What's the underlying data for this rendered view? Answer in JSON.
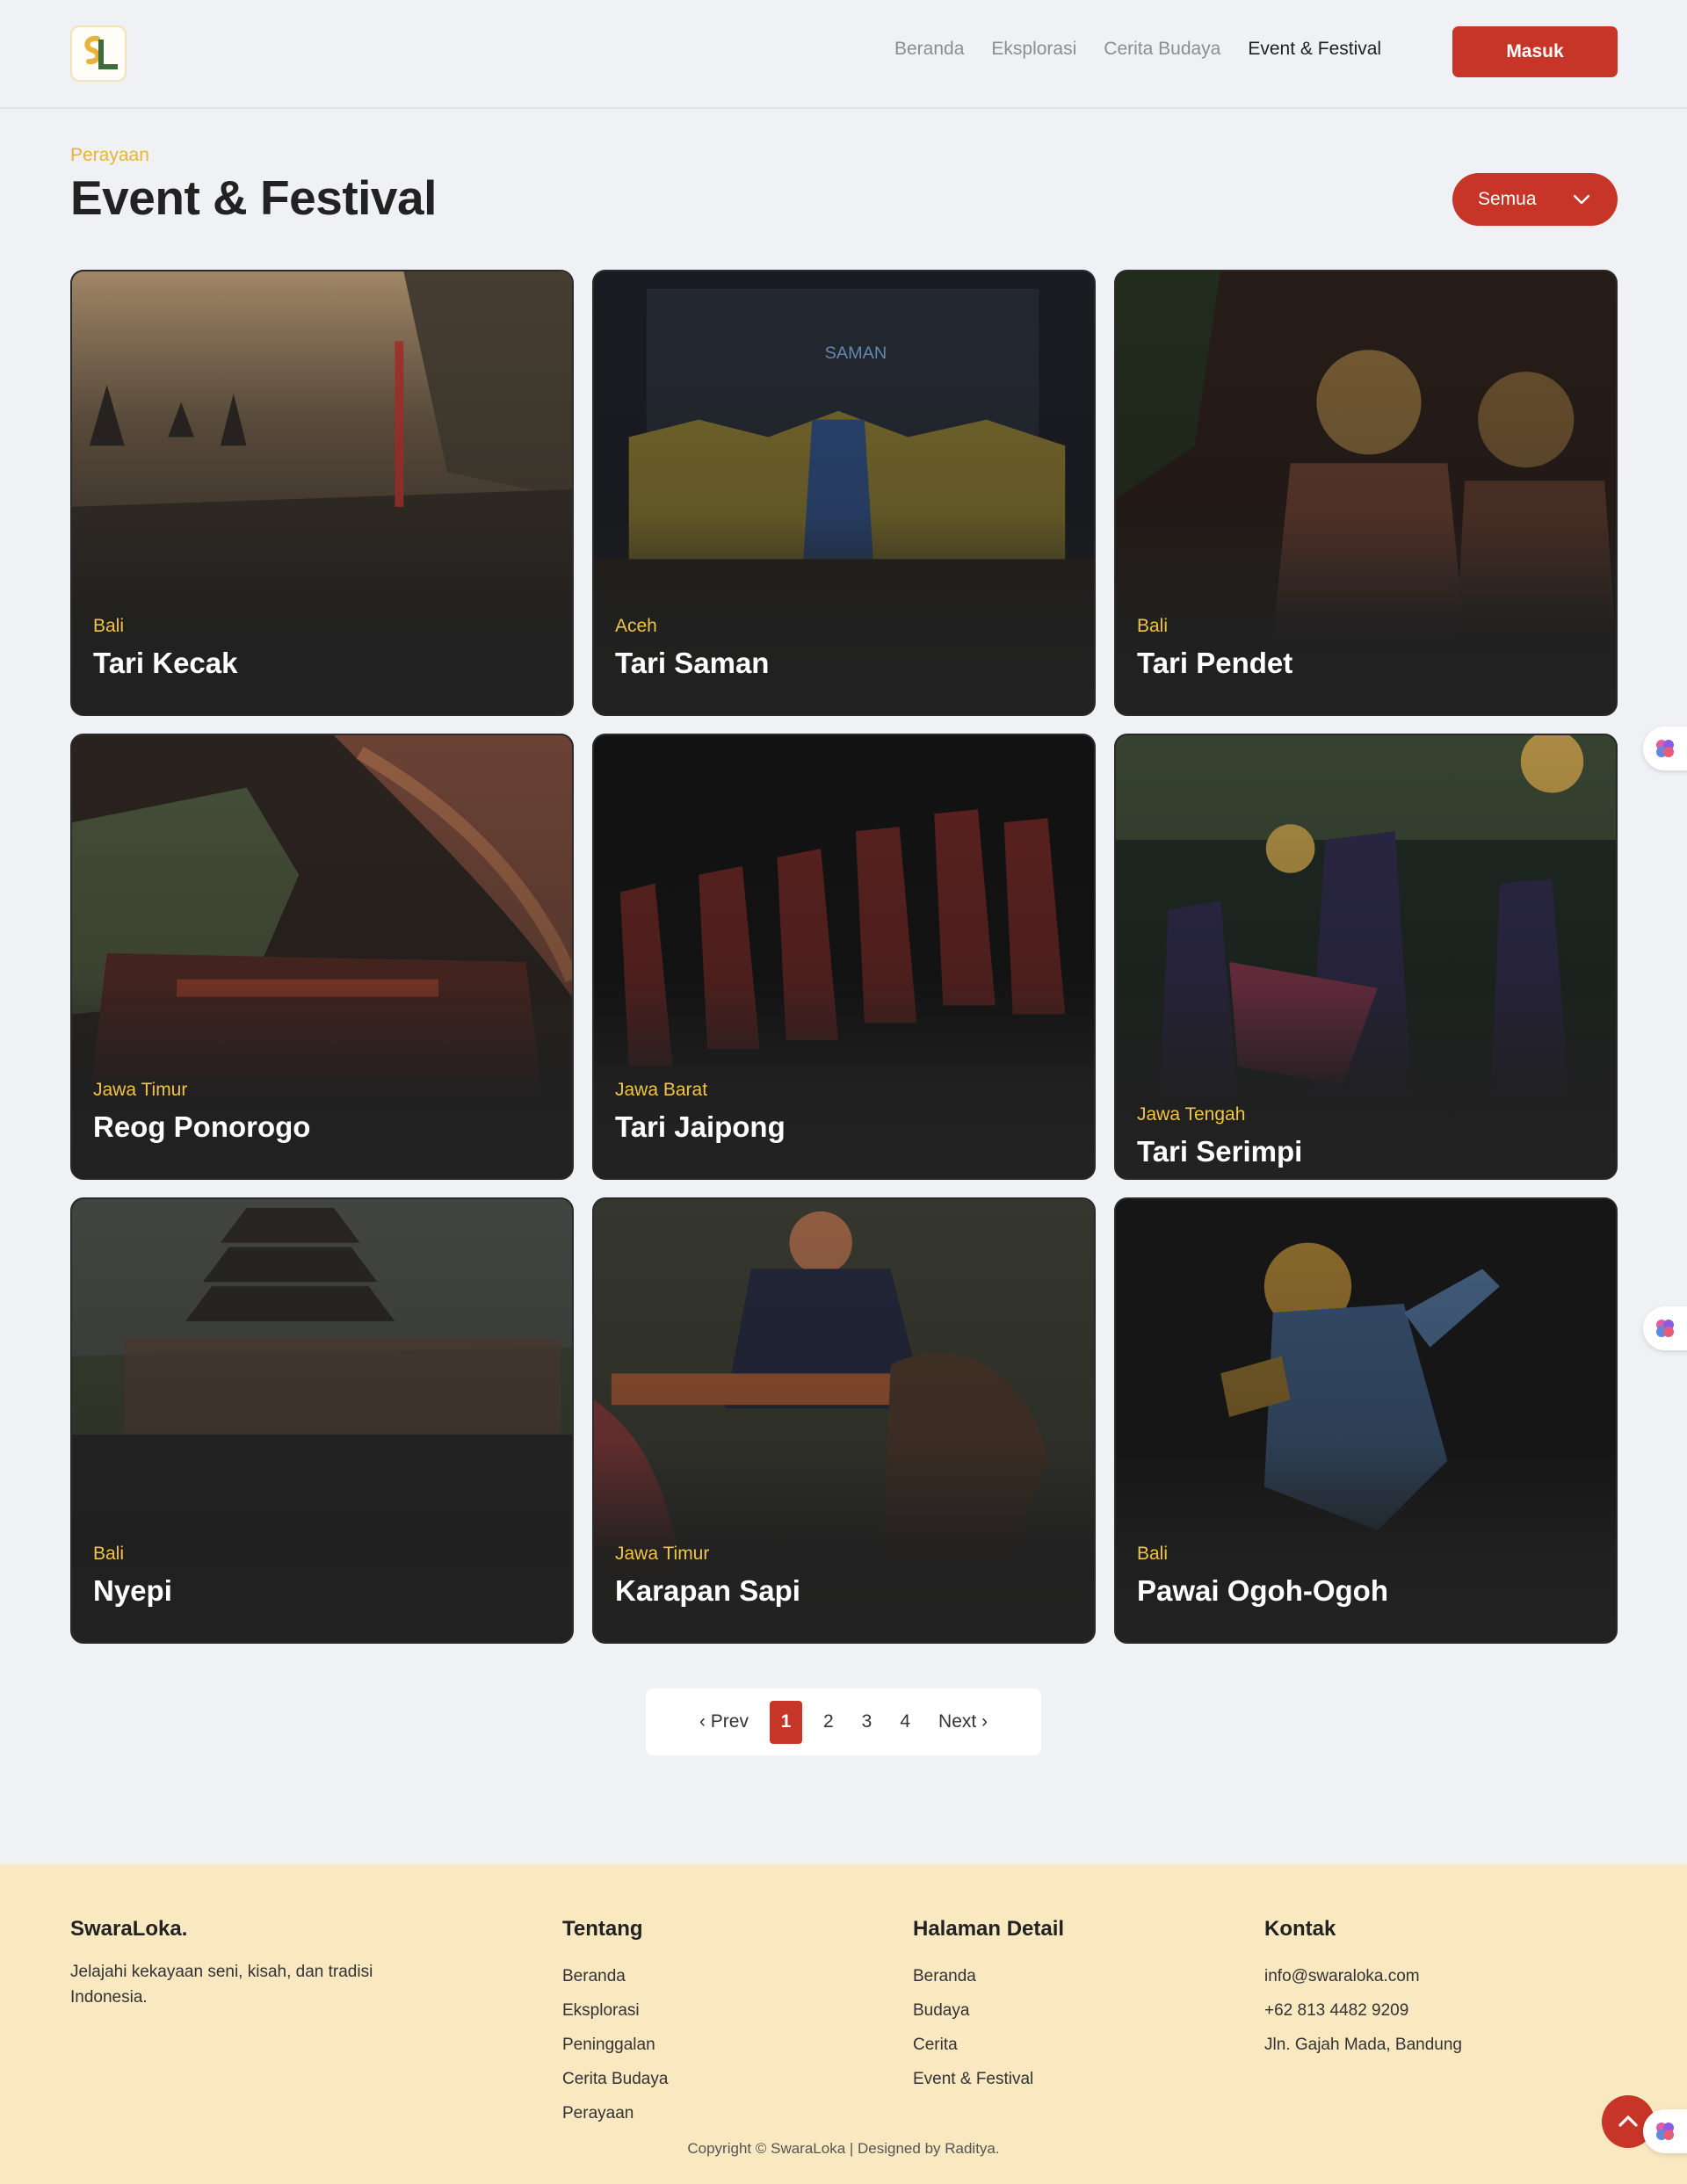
{
  "header": {
    "logo_alt": "SL",
    "nav": [
      {
        "label": "Beranda"
      },
      {
        "label": "Eksplorasi"
      },
      {
        "label": "Cerita Budaya"
      },
      {
        "label": "Event & Festival"
      }
    ],
    "active_nav": "Event & Festival",
    "login_label": "Masuk"
  },
  "main": {
    "eyebrow": "Perayaan",
    "title": "Event & Festival",
    "filter_label": "Semua",
    "cards": [
      {
        "region": "Bali",
        "name": "Tari Kecak"
      },
      {
        "region": "Aceh",
        "name": "Tari Saman"
      },
      {
        "region": "Bali",
        "name": "Tari Pendet"
      },
      {
        "region": "Jawa Timur",
        "name": "Reog Ponorogo"
      },
      {
        "region": "Jawa Barat",
        "name": "Tari Jaipong"
      },
      {
        "region": "Jawa Tengah",
        "name": "Tari Serimpi"
      },
      {
        "region": "Bali",
        "name": "Nyepi"
      },
      {
        "region": "Jawa Timur",
        "name": "Karapan Sapi"
      },
      {
        "region": "Bali",
        "name": "Pawai Ogoh-Ogoh"
      }
    ],
    "pagination": {
      "prev": "‹ Prev",
      "pages": [
        "1",
        "2",
        "3",
        "4"
      ],
      "current": "1",
      "next": "Next ›"
    }
  },
  "footer": {
    "brand": "SwaraLoka.",
    "tagline": "Jelajahi kekayaan seni, kisah, dan tradisi Indonesia.",
    "about_title": "Tentang",
    "about_links": [
      "Beranda",
      "Eksplorasi",
      "Peninggalan",
      "Cerita Budaya",
      "Perayaan"
    ],
    "detail_title": "Halaman Detail",
    "detail_links": [
      "Beranda",
      "Budaya",
      "Cerita",
      "Event & Festival"
    ],
    "contact_title": "Kontak",
    "contact": [
      "info@swaraloka.com",
      "+62 813 4482 9209",
      "Jln. Gajah Mada, Bandung"
    ],
    "copyright": "Copyright © SwaraLoka | Designed by Raditya."
  },
  "colors": {
    "accent": "#c63528",
    "gold": "#e6b43a",
    "footer_bg": "#f9e8c0",
    "page_bg": "#f0f1f5"
  },
  "icons": [
    "chevron-down-icon",
    "chevron-up-icon",
    "brain-icon"
  ]
}
